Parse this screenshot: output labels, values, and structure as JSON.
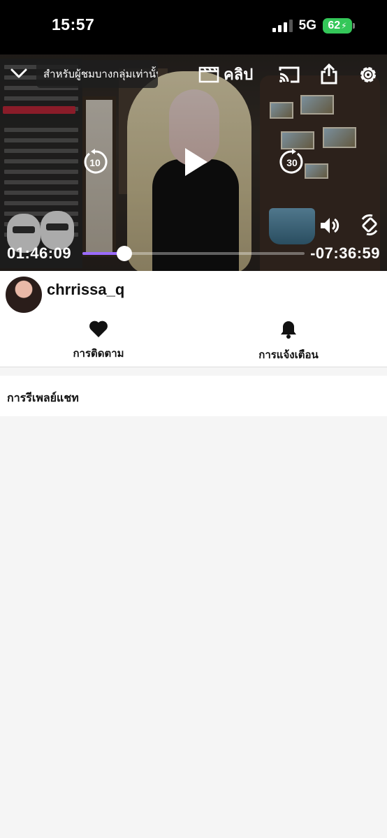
{
  "status_bar": {
    "time": "15:57",
    "network": "5G",
    "battery": "62"
  },
  "player": {
    "audience_banner": "สำหรับผู้ชมบางกลุ่มเท่านั้น",
    "clip_label": "คลิป",
    "rewind_seconds": "10",
    "forward_seconds": "30",
    "elapsed": "01:46:09",
    "remaining": "-07:36:59",
    "progress_fraction": 0.19,
    "accent_color": "#9b6bff"
  },
  "channel": {
    "username": "chrrissa_q"
  },
  "actions": {
    "follow_label": "การติดตาม",
    "notify_label": "การแจ้งเตือน"
  },
  "replay": {
    "title": "การรีเพลย์แชท"
  }
}
